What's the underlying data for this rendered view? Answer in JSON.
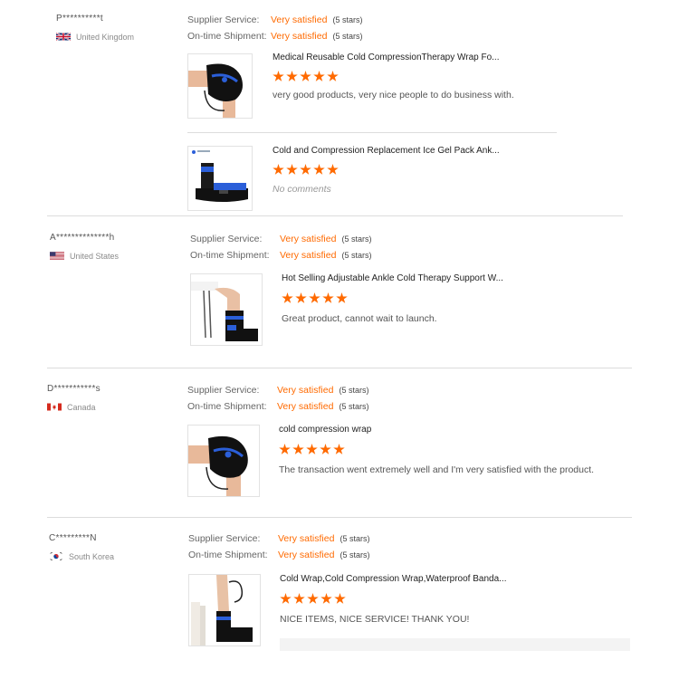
{
  "reviews": [
    {
      "buyer": "P**********t",
      "country": "United Kingdom",
      "supplier_label": "Supplier Service:",
      "supplier_value": "Very satisfied",
      "supplier_stars": "(5 stars)",
      "shipment_label": "On-time Shipment:",
      "shipment_value": "Very satisfied",
      "shipment_stars": "(5 stars)",
      "products": [
        {
          "title": "Medical Reusable Cold CompressionTherapy Wrap Fo...",
          "rating": 5,
          "comment": "very good products, very nice people to do business with."
        },
        {
          "title": "Cold and Compression Replacement Ice Gel Pack Ank...",
          "rating": 5,
          "comment": "No comments"
        }
      ]
    },
    {
      "buyer": "A**************h",
      "country": "United States",
      "supplier_label": "Supplier Service:",
      "supplier_value": "Very satisfied",
      "supplier_stars": "(5 stars)",
      "shipment_label": "On-time Shipment:",
      "shipment_value": "Very satisfied",
      "shipment_stars": "(5 stars)",
      "products": [
        {
          "title": "Hot Selling Adjustable Ankle Cold Therapy Support W...",
          "rating": 5,
          "comment": "Great product, cannot wait to launch."
        }
      ]
    },
    {
      "buyer": "D***********s",
      "country": "Canada",
      "supplier_label": "Supplier Service:",
      "supplier_value": "Very satisfied",
      "supplier_stars": "(5 stars)",
      "shipment_label": "On-time Shipment:",
      "shipment_value": "Very satisfied",
      "shipment_stars": "(5 stars)",
      "products": [
        {
          "title": "cold compression wrap",
          "rating": 5,
          "comment": "The transaction went extremely well and I'm very satisfied with the product."
        }
      ]
    },
    {
      "buyer": "C*********N",
      "country": "South Korea",
      "supplier_label": "Supplier Service:",
      "supplier_value": "Very satisfied",
      "supplier_stars": "(5 stars)",
      "shipment_label": "On-time Shipment:",
      "shipment_value": "Very satisfied",
      "shipment_stars": "(5 stars)",
      "products": [
        {
          "title": "Cold Wrap,Cold Compression Wrap,Waterproof Banda...",
          "rating": 5,
          "comment": "NICE ITEMS, NICE SERVICE! THANK YOU!"
        }
      ]
    }
  ],
  "colors": {
    "accent": "#ff6a00",
    "divider": "#dcdcdc"
  },
  "icons": [
    "uk-flag-icon",
    "us-flag-icon",
    "canada-flag-icon",
    "south-korea-flag-icon",
    "star-icon"
  ]
}
